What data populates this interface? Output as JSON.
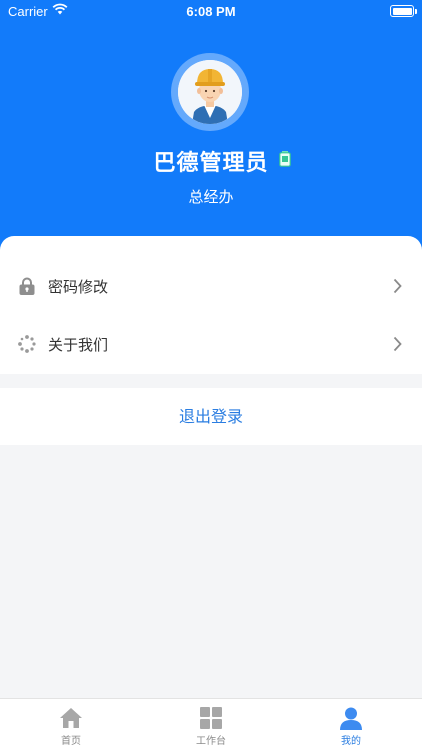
{
  "status_bar": {
    "carrier": "Carrier",
    "time": "6:08 PM"
  },
  "profile": {
    "name": "巴德管理员",
    "department": "总经办"
  },
  "menu": [
    {
      "label": "密码修改",
      "icon": "lock-icon"
    },
    {
      "label": "关于我们",
      "icon": "about-icon"
    }
  ],
  "logout_label": "退出登录",
  "tabs": [
    {
      "label": "首页",
      "icon": "home-icon"
    },
    {
      "label": "工作台",
      "icon": "grid-icon"
    },
    {
      "label": "我的",
      "icon": "user-icon",
      "active": true
    }
  ],
  "colors": {
    "primary": "#127bfa",
    "link": "#2a7de1",
    "background": "#f4f5f7"
  }
}
